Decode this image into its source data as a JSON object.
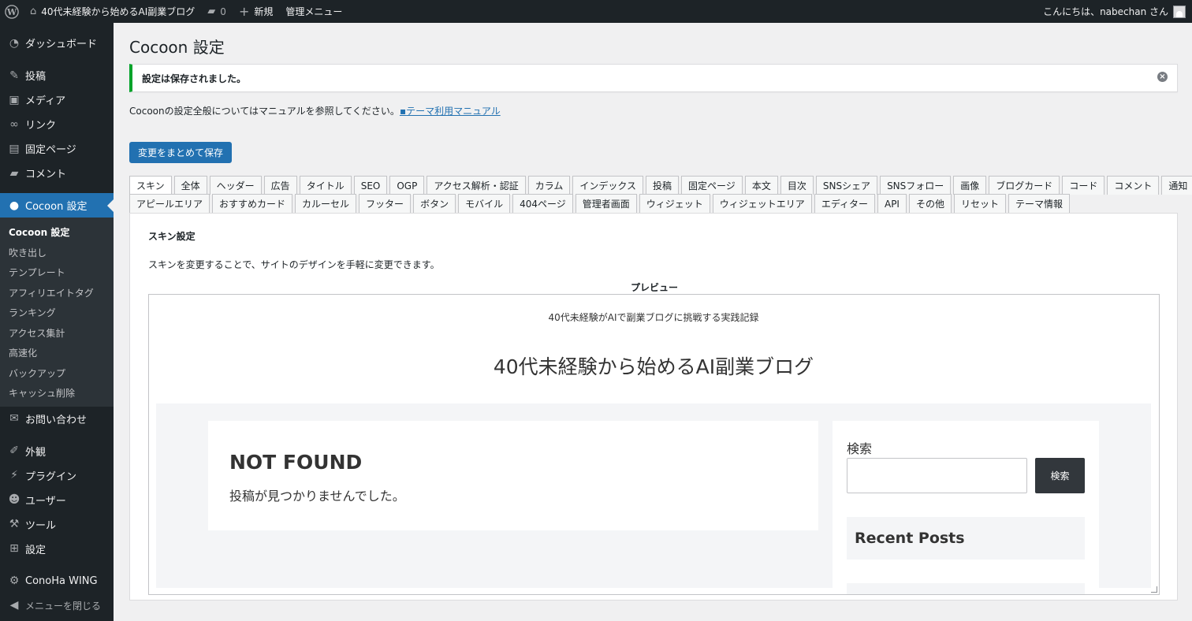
{
  "adminbar": {
    "site_name": "40代未経験から始めるAI副業ブログ",
    "comments_count": "0",
    "new_label": "新規",
    "admin_menu_label": "管理メニュー",
    "greeting": "こんにちは、nabechan さん"
  },
  "sidebar": {
    "items": [
      {
        "label": "ダッシュボード",
        "icon": "dashboard-icon"
      },
      {
        "label": "投稿",
        "icon": "pin-icon"
      },
      {
        "label": "メディア",
        "icon": "media-icon"
      },
      {
        "label": "リンク",
        "icon": "link-icon"
      },
      {
        "label": "固定ページ",
        "icon": "page-icon"
      },
      {
        "label": "コメント",
        "icon": "comment-icon"
      },
      {
        "label": "Cocoon 設定",
        "icon": "cocoon-icon"
      },
      {
        "label": "お問い合わせ",
        "icon": "mail-icon"
      },
      {
        "label": "外観",
        "icon": "brush-icon"
      },
      {
        "label": "プラグイン",
        "icon": "plugin-icon"
      },
      {
        "label": "ユーザー",
        "icon": "user-icon"
      },
      {
        "label": "ツール",
        "icon": "wrench-icon"
      },
      {
        "label": "設定",
        "icon": "settings-icon"
      },
      {
        "label": "ConoHa WING",
        "icon": "gear-icon"
      },
      {
        "label": "メニューを閉じる",
        "icon": "collapse-icon"
      }
    ],
    "submenu": [
      "Cocoon 設定",
      "吹き出し",
      "テンプレート",
      "アフィリエイトタグ",
      "ランキング",
      "アクセス集計",
      "高速化",
      "バックアップ",
      "キャッシュ削除"
    ]
  },
  "page": {
    "title": "Cocoon 設定",
    "notice": "設定は保存されました。",
    "intro_text": "Cocoonの設定全般についてはマニュアルを参照してください。",
    "manual_link": "テーマ利用マニュアル",
    "save_button": "変更をまとめて保存"
  },
  "tabs": {
    "row1": [
      "スキン",
      "全体",
      "ヘッダー",
      "広告",
      "タイトル",
      "SEO",
      "OGP",
      "アクセス解析・認証",
      "カラム",
      "インデックス",
      "投稿",
      "固定ページ",
      "本文",
      "目次",
      "SNSシェア",
      "SNSフォロー",
      "画像",
      "ブログカード",
      "コード",
      "コメント",
      "通知"
    ],
    "row2": [
      "アピールエリア",
      "おすすめカード",
      "カルーセル",
      "フッター",
      "ボタン",
      "モバイル",
      "404ページ",
      "管理者画面",
      "ウィジェット",
      "ウィジェットエリア",
      "エディター",
      "API",
      "その他",
      "リセット",
      "テーマ情報"
    ],
    "active": "スキン"
  },
  "skin_panel": {
    "title": "スキン設定",
    "description": "スキンを変更することで、サイトのデザインを手軽に変更できます。",
    "preview_label": "プレビュー"
  },
  "preview": {
    "tagline": "40代未経験がAIで副業ブログに挑戦する実践記録",
    "site_name": "40代未経験から始めるAI副業ブログ",
    "not_found_title": "NOT FOUND",
    "not_found_text": "投稿が見つかりませんでした。",
    "search_label": "検索",
    "search_button": "検索",
    "recent_posts": "Recent Posts"
  },
  "colors": {
    "admin_dark": "#1d2327",
    "accent": "#2271b1",
    "success": "#00a32a"
  }
}
